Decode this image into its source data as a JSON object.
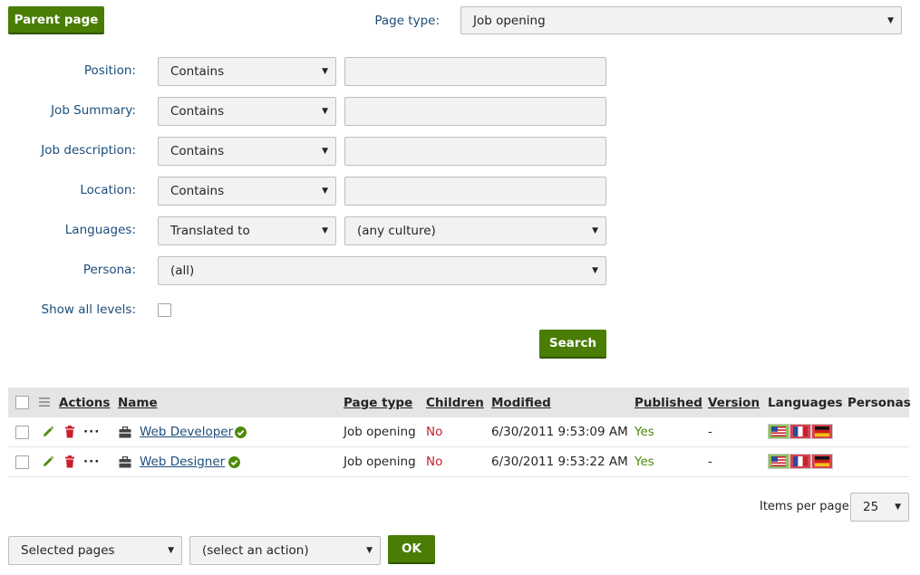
{
  "header": {
    "parent_page_label": "Parent page",
    "page_type_label": "Page type:",
    "page_type_value": "Job opening"
  },
  "filters": [
    {
      "label": "Position:",
      "operator": "Contains",
      "value": ""
    },
    {
      "label": "Job Summary:",
      "operator": "Contains",
      "value": ""
    },
    {
      "label": "Job description:",
      "operator": "Contains",
      "value": ""
    },
    {
      "label": "Location:",
      "operator": "Contains",
      "value": ""
    }
  ],
  "languages": {
    "label": "Languages:",
    "operator": "Translated to",
    "culture": "(any culture)"
  },
  "persona": {
    "label": "Persona:",
    "value": "(all)"
  },
  "show_all_levels": {
    "label": "Show all levels:",
    "checked": false
  },
  "search_label": "Search",
  "grid": {
    "columns": {
      "actions": "Actions",
      "name": "Name",
      "page_type": "Page type",
      "children": "Children",
      "modified": "Modified",
      "published": "Published",
      "version": "Version",
      "languages": "Languages",
      "personas": "Personas"
    },
    "rows": [
      {
        "name": "Web Developer",
        "page_type": "Job opening",
        "children": "No",
        "modified": "6/30/2011 9:53:09 AM",
        "published": "Yes",
        "version": "-"
      },
      {
        "name": "Web Designer",
        "page_type": "Job opening",
        "children": "No",
        "modified": "6/30/2011 9:53:22 AM",
        "published": "Yes",
        "version": "-"
      }
    ],
    "more_actions_glyph": "···"
  },
  "pager": {
    "items_per_page_label": "Items per page",
    "items_per_page_value": "25"
  },
  "mass_action": {
    "scope": "Selected pages",
    "action": "(select an action)",
    "ok_label": "OK"
  },
  "colors": {
    "accent_green": "#497d04",
    "label_blue": "#1c4d7a",
    "danger_red": "#c8202f"
  },
  "icons": [
    "edit-icon",
    "delete-icon",
    "more-actions-icon",
    "page-type-icon",
    "published-check-icon",
    "flag-us-icon",
    "flag-fr-icon",
    "flag-de-icon",
    "column-menu-icon",
    "dropdown-caret-icon"
  ]
}
